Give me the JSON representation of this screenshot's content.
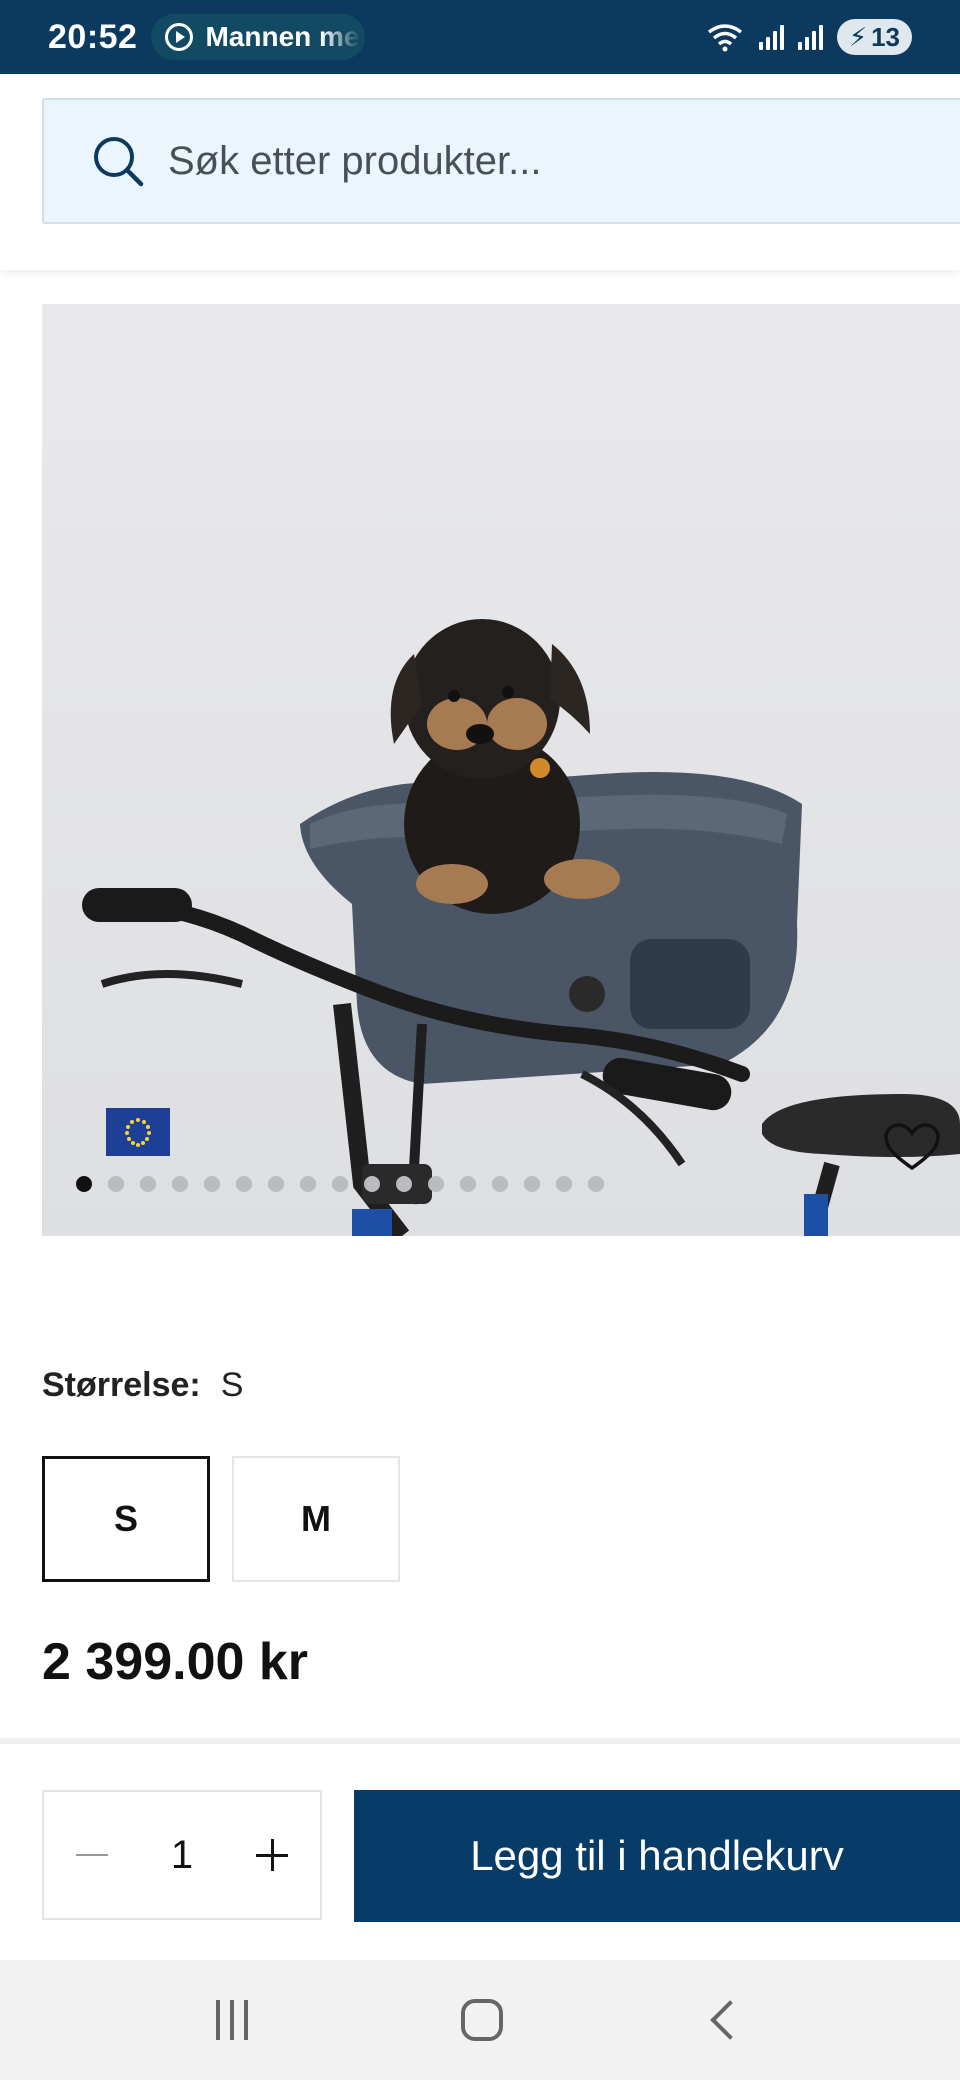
{
  "status_bar": {
    "time": "20:52",
    "media_text": "Mannen me",
    "battery_level": "13",
    "icons": [
      "play-icon",
      "wifi-icon",
      "signal-icon",
      "battery-icon"
    ]
  },
  "search": {
    "placeholder": "Søk etter produkter...",
    "icon": "search-icon"
  },
  "product": {
    "image_alt_icons": [
      "eu-flag-icon",
      "heart-icon"
    ],
    "carousel": {
      "total": 17,
      "active_index": 0
    },
    "size_label": "Størrelse:",
    "selected_size": "S",
    "sizes": [
      "S",
      "M"
    ],
    "price": "2 399.00 kr"
  },
  "cart": {
    "quantity": "1",
    "add_label": "Legg til i handlekurv"
  },
  "colors": {
    "brand": "#0b3a5e",
    "button": "#073c68",
    "search_bg": "#ebf5fd"
  }
}
